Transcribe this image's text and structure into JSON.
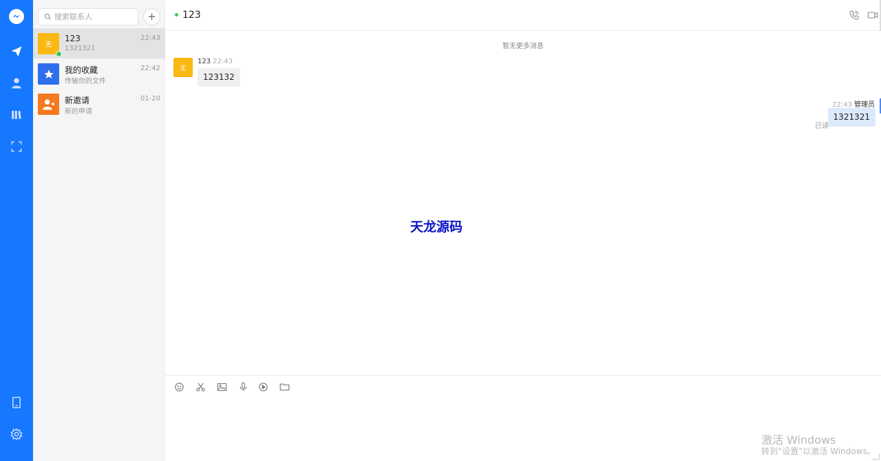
{
  "nav": {
    "items": [
      {
        "name": "messenger-logo-icon"
      },
      {
        "name": "send-icon"
      },
      {
        "name": "contacts-icon"
      },
      {
        "name": "library-icon"
      },
      {
        "name": "scan-icon"
      },
      {
        "name": "tablet-icon"
      },
      {
        "name": "settings-icon"
      }
    ],
    "color": "#1677ff"
  },
  "search": {
    "placeholder": "搜索联系人",
    "add_label": "+"
  },
  "conversations": [
    {
      "avatar_text": "无",
      "avatar_color": "#f9b812",
      "name": "123",
      "subtitle": "1321321",
      "time": "22:43",
      "active": true,
      "online": true
    },
    {
      "avatar_text": "",
      "avatar_color": "#2f6fee",
      "name": "我的收藏",
      "subtitle": "传输你的文件",
      "time": "22:42",
      "active": false
    },
    {
      "avatar_text": "",
      "avatar_color": "#f5791f",
      "name": "新邀请",
      "subtitle": "新的申请",
      "time": "01-20",
      "active": false
    }
  ],
  "chat": {
    "title": "123",
    "no_more": "暂无更多消息",
    "incoming": {
      "avatar_text": "无",
      "sender": "123",
      "time": "22:43",
      "text": "123132"
    },
    "outgoing": {
      "time": "22:43",
      "sender": "管理员",
      "text": "1321321",
      "status": "已读"
    },
    "watermark": "天龙源码"
  },
  "windows": {
    "line1": "激活 Windows",
    "line2": "转到“设置”以激活 Windows。"
  }
}
